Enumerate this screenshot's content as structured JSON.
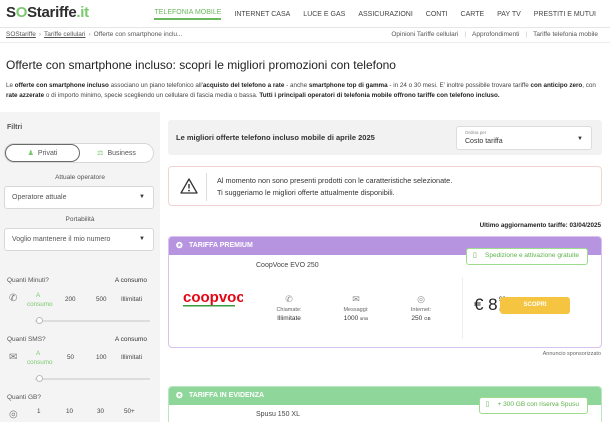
{
  "logo": {
    "part1": "S",
    "part2": "Stariffe",
    "part3": ".it"
  },
  "nav": {
    "items": [
      {
        "label": "TELEFONIA MOBILE",
        "active": true
      },
      {
        "label": "INTERNET CASA",
        "active": false
      },
      {
        "label": "LUCE E GAS",
        "active": false
      },
      {
        "label": "ASSICURAZIONI",
        "active": false
      },
      {
        "label": "CONTI",
        "active": false
      },
      {
        "label": "CARTE",
        "active": false
      },
      {
        "label": "PAY TV",
        "active": false
      },
      {
        "label": "PRESTITI E MUTUI",
        "active": false
      }
    ]
  },
  "breadcrumb": {
    "home": "SOStariffe",
    "section": "Tariffe cellulari",
    "current": "Offerte con smartphone inclu..."
  },
  "sublinks": {
    "opinions": "Opinioni Tariffe cellulari",
    "guides": "Approfondimenti",
    "rates": "Tariffe telefonia mobile"
  },
  "page_title": "Offerte con smartphone incluso: scopri le migliori promozioni con telefono",
  "intro": {
    "t1": "Le ",
    "b1": "offerte con smartphone incluso",
    "t2": " associano un piano telefonico all'",
    "b2": "acquisto del telefono a rate",
    "t3": " - anche ",
    "b3": "smartphone top di gamma",
    "t4": " - in 24 o 30 mesi. E' inoltre possibile trovare tariffe ",
    "b4": "con anticipo zero",
    "t5": ", con ",
    "b5": "rate azzerate",
    "t6": " o di importo minimo, specie scegliendo un cellulare di fascia media o bassa. ",
    "b6": "Tutti i principali operatori di telefonia mobile offrono tariffe con telefono incluso."
  },
  "sidebar": {
    "title": "Filtri",
    "segment": {
      "private": "Privati",
      "business": "Business"
    },
    "operator_label": "Attuale operatore",
    "operator_value": "Operatore attuale",
    "portability_label": "Portabilità",
    "portability_value": "Voglio mantenere il mio numero",
    "minutes": {
      "label": "Quanti Minuti?",
      "selected": "A consumo",
      "opts": [
        "A",
        "consumo",
        "200",
        "500",
        "Illimitati"
      ]
    },
    "sms": {
      "label": "Quanti SMS?",
      "selected": "A consumo",
      "opts": [
        "A",
        "consumo",
        "50",
        "100",
        "Illimitati"
      ]
    },
    "gb": {
      "label": "Quanti GB?",
      "opts": [
        "1",
        "10",
        "30",
        "50+"
      ]
    }
  },
  "main": {
    "heading": "Le migliori offerte telefono incluso mobile di aprile 2025",
    "sort_caption": "Ordina per",
    "sort_value": "Costo tariffa",
    "alert_line1": "Al momento non sono presenti prodotti con le caratteristiche selezionate.",
    "alert_line2": "Ti suggeriamo le migliori offerte attualmente disponibili.",
    "updated": "Ultimo aggiornamento tariffe: 03/04/2025",
    "sponsored": "Annuncio sponsorizzato"
  },
  "offer1": {
    "badge": "TARIFFA PREMIUM",
    "promo": "Spedizione e attivazione gratuite",
    "name": "CoopVoce EVO 250",
    "brand": "coopvoce",
    "calls_label": "Chiamate:",
    "calls_value": "Illimitate",
    "sms_label": "Messaggi:",
    "sms_value": "1000",
    "sms_unit": "sms",
    "data_label": "Internet:",
    "data_value": "250",
    "data_unit": "GB",
    "price_int": "€ 8",
    "price_dec": "90",
    "price_per": "/mese",
    "cta": "SCOPRI",
    "header_color": "#b794e0"
  },
  "offer2": {
    "badge": "TARIFFA IN EVIDENZA",
    "promo": "+ 300 GB con riserva Spusu",
    "name": "Spusu 150 XL",
    "header_color": "#8ed69a"
  },
  "colors": {
    "accent": "#69b85d",
    "cta": "#f5c542"
  }
}
